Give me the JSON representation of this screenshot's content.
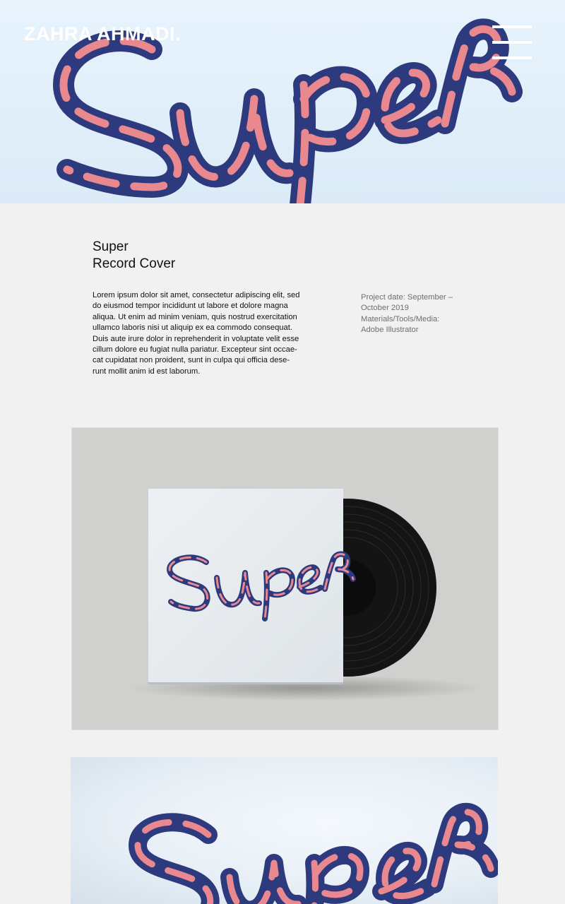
{
  "header": {
    "logo": "ZAHRA AHMADI."
  },
  "hero": {
    "artwork_word": "Super",
    "colors": {
      "navy": "#2e3a7e",
      "pink": "#e9898f",
      "background": "#e2eff9"
    }
  },
  "project": {
    "title_lines": [
      "Super",
      "Record Cover"
    ],
    "description_lines": [
      "Lorem ipsum dolor sit amet, consectetur adipiscing elit, sed",
      "do eiusmod tempor incididunt ut labore et dolore magna",
      "aliqua. Ut enim ad minim veniam, quis nostrud exercitation",
      "ullamco laboris nisi ut aliquip ex ea commodo consequat.",
      "Duis aute irure dolor in reprehenderit in voluptate velit esse",
      "cillum dolore eu fugiat nulla pariatur. Excepteur sint occae-",
      "cat cupidatat non proident, sunt in culpa qui officia dese-",
      "runt mollit anim id est laborum."
    ],
    "meta_lines": [
      "Project date: September –",
      "October 2019",
      "Materials/Tools/Media:",
      "Adobe Illustrator"
    ]
  }
}
